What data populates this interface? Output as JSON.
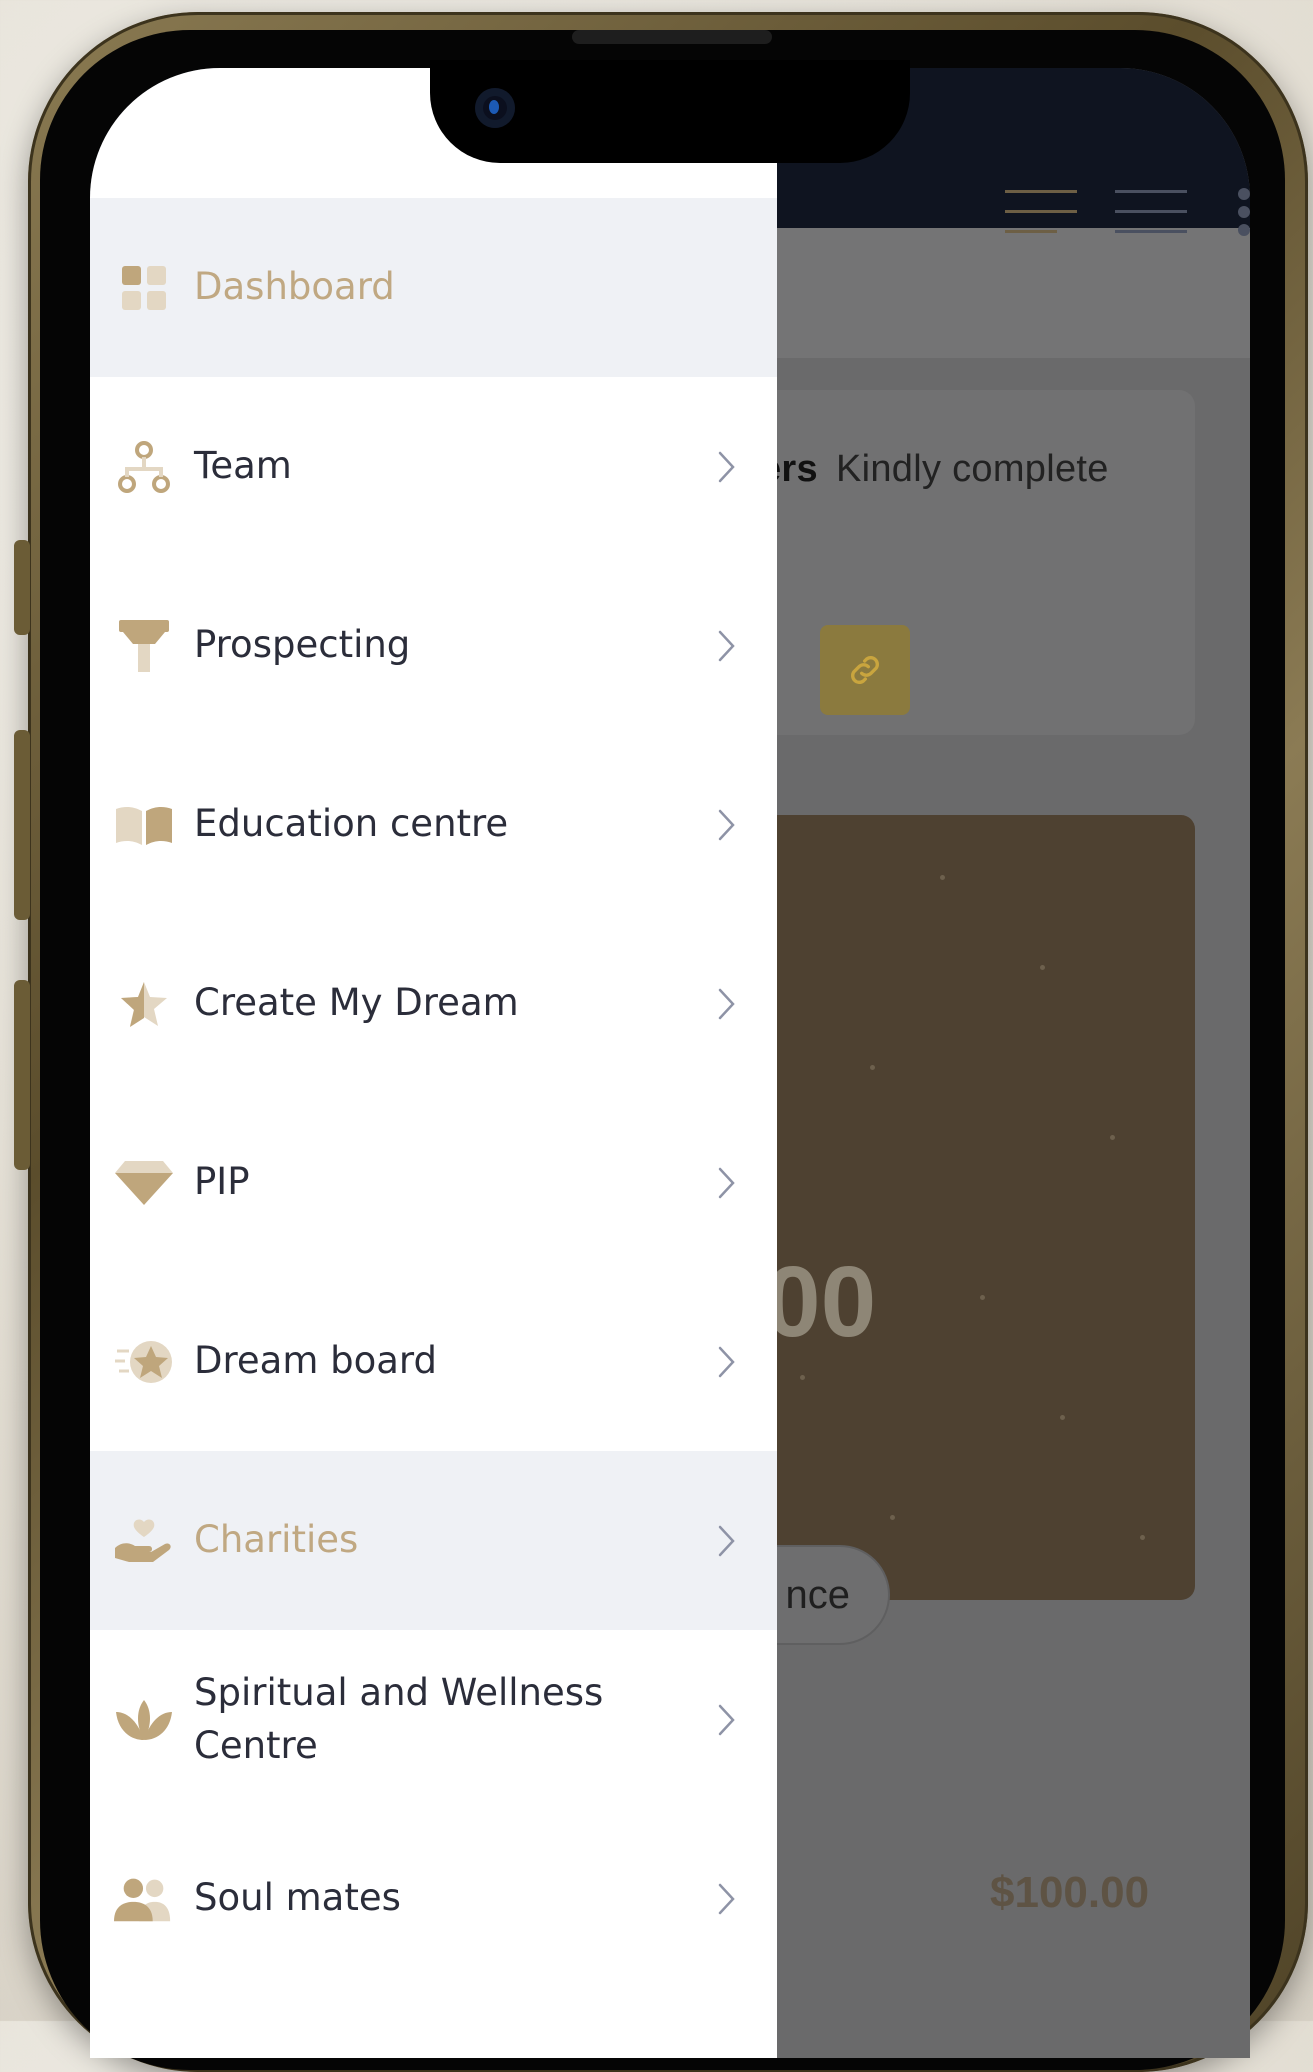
{
  "background_app": {
    "card_text_bold": "ers",
    "card_text": "Kindly complete",
    "banner_amount_fragment": "00",
    "pill_button_fragment": "nce",
    "amount": "$100.00",
    "link_icon": "link-icon",
    "menu_icons": [
      "align-lines-icon",
      "hamburger-icon",
      "kebab-icon"
    ]
  },
  "menu": {
    "items": [
      {
        "label": "Dashboard",
        "icon": "dashboard-icon",
        "active": true,
        "has_chevron": false
      },
      {
        "label": "Team",
        "icon": "team-hierarchy-icon",
        "active": false,
        "has_chevron": true
      },
      {
        "label": "Prospecting",
        "icon": "funnel-icon",
        "active": false,
        "has_chevron": true
      },
      {
        "label": "Education centre",
        "icon": "book-icon",
        "active": false,
        "has_chevron": true
      },
      {
        "label": "Create My Dream",
        "icon": "star-icon",
        "active": false,
        "has_chevron": true
      },
      {
        "label": "PIP",
        "icon": "diamond-icon",
        "active": false,
        "has_chevron": true
      },
      {
        "label": "Dream board",
        "icon": "star-badge-icon",
        "active": false,
        "has_chevron": true
      },
      {
        "label": "Charities",
        "icon": "charity-hand-icon",
        "active": true,
        "has_chevron": true
      },
      {
        "label": "Spiritual and Wellness Centre",
        "icon": "lotus-icon",
        "active": false,
        "has_chevron": true
      },
      {
        "label": "Soul mates",
        "icon": "soulmates-icon",
        "active": false,
        "has_chevron": true
      }
    ]
  },
  "colors": {
    "accent": "#c0a882",
    "icon_gold": "#bfa67c",
    "icon_light": "#e3d7c3",
    "active_bg": "#eff1f5",
    "text": "#2b2d3a",
    "chevron": "#8e93a6"
  }
}
